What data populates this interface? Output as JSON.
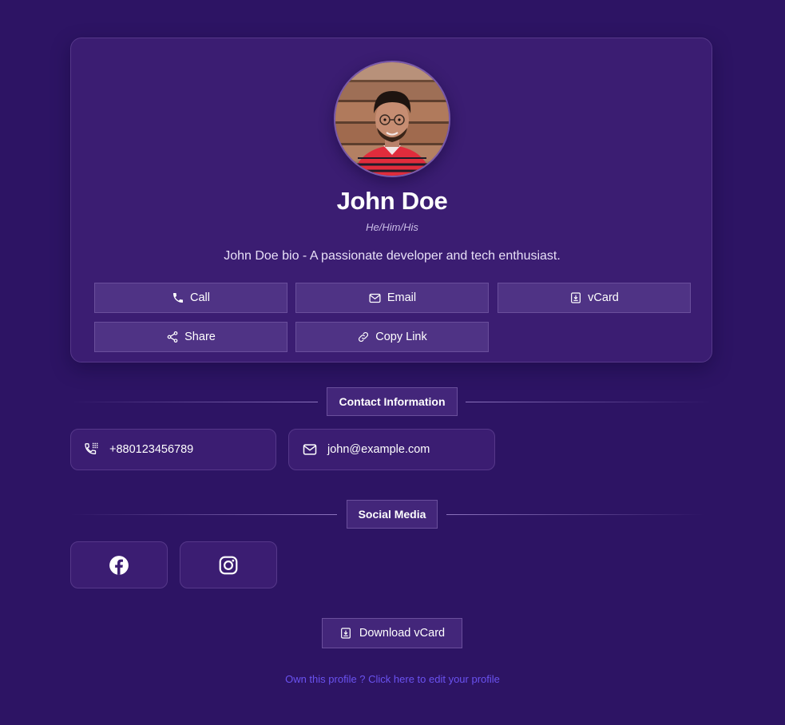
{
  "profile": {
    "name": "John Doe",
    "pronouns": "He/Him/His",
    "bio": "John Doe bio - A passionate developer and tech enthusiast."
  },
  "actions": {
    "call_label": "Call",
    "email_label": "Email",
    "vcard_label": "vCard",
    "share_label": "Share",
    "copy_link_label": "Copy Link"
  },
  "contact": {
    "section_title": "Contact Information",
    "phone": "+880123456789",
    "email": "john@example.com"
  },
  "social": {
    "section_title": "Social Media",
    "items": [
      {
        "icon": "facebook-icon"
      },
      {
        "icon": "instagram-icon"
      }
    ]
  },
  "footer": {
    "download_label": "Download vCard",
    "edit_link": "Own this profile ? Click here to edit your profile"
  },
  "colors": {
    "background": "#2d1464",
    "card": "#3b1d72",
    "button": "#4f3385",
    "link": "#6a52f0"
  }
}
